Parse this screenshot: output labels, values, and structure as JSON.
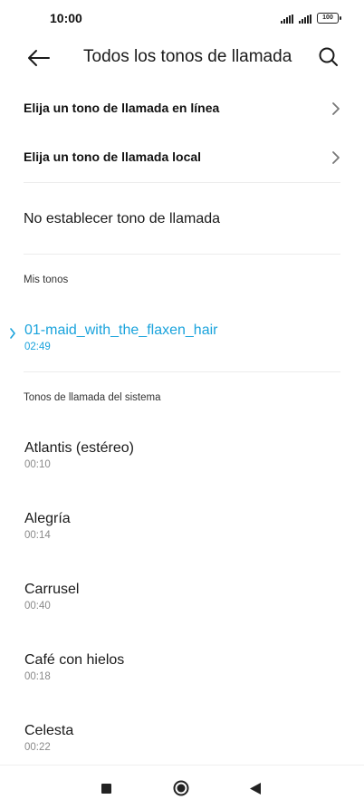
{
  "status_bar": {
    "time": "10:00",
    "battery": "100"
  },
  "header": {
    "title": "Todos los tonos de llamada",
    "back_icon": "arrow-left-icon",
    "search_icon": "search-icon"
  },
  "options": [
    {
      "label": "Elija un tono de llamada en línea"
    },
    {
      "label": "Elija un tono de llamada local"
    }
  ],
  "no_ringtone": "No establecer tono de llamada",
  "my_tones": {
    "header": "Mis tonos",
    "items": [
      {
        "name": "01-maid_with_the_flaxen_hair",
        "duration": "02:49",
        "selected": true
      }
    ]
  },
  "system_tones": {
    "header": "Tonos de llamada del sistema",
    "items": [
      {
        "name": "Atlantis (estéreo)",
        "duration": "00:10"
      },
      {
        "name": "Alegría",
        "duration": "00:14"
      },
      {
        "name": "Carrusel",
        "duration": "00:40"
      },
      {
        "name": "Café con hielos",
        "duration": "00:18"
      },
      {
        "name": "Celesta",
        "duration": "00:22"
      }
    ]
  },
  "colors": {
    "accent": "#1aa3dc",
    "secondary_text": "#8a8a8a"
  }
}
